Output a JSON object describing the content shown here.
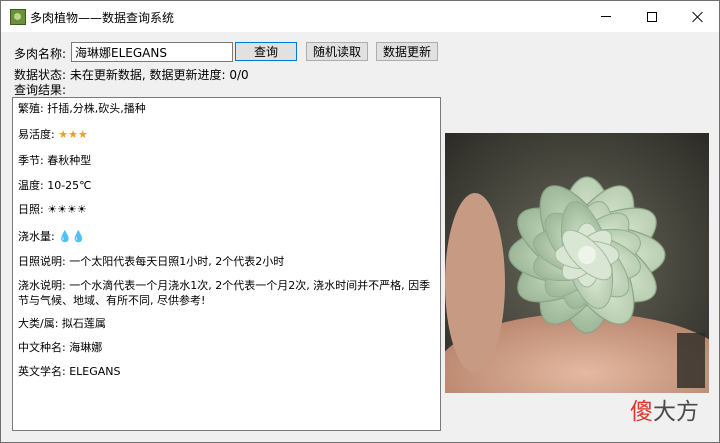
{
  "window": {
    "title": "多肉植物——数据查询系统"
  },
  "form": {
    "name_label": "多肉名称:",
    "name_value": "海琳娜ELEGANS",
    "query_button": "查询",
    "random_button": "随机读取",
    "update_button": "数据更新",
    "status_text": "数据状态: 未在更新数据, 数据更新进度: 0/0",
    "result_label": "查询结果:"
  },
  "result": {
    "propagation": "繁殖: 扦插,分株,砍头,播种",
    "ease_label": "易活度: ",
    "ease_stars": "★★★",
    "season": "季节: 春秋种型",
    "temperature": "温度: 10-25℃",
    "sunlight_label": "日照: ",
    "sunlight_icons": "☀☀☀☀",
    "water_label": "浇水量: ",
    "water_icons": "💧💧",
    "sunlight_note": "日照说明: 一个太阳代表每天日照1小时, 2个代表2小时",
    "water_note": "浇水说明: 一个水滴代表一个月浇水1次, 2个代表一个月2次, 浇水时间并不严格, 因季节与气候、地域、有所不同, 尽供参考!",
    "family": "大类/属: 拟石莲属",
    "chinese_name": "中文种名: 海琳娜",
    "latin_name": "英文学名: ELEGANS"
  },
  "watermark": {
    "part1": "傻",
    "part2": "大方"
  },
  "icons": {
    "app": "succulent-app-icon",
    "minimize": "minimize-icon",
    "maximize": "maximize-icon",
    "close": "close-icon"
  }
}
